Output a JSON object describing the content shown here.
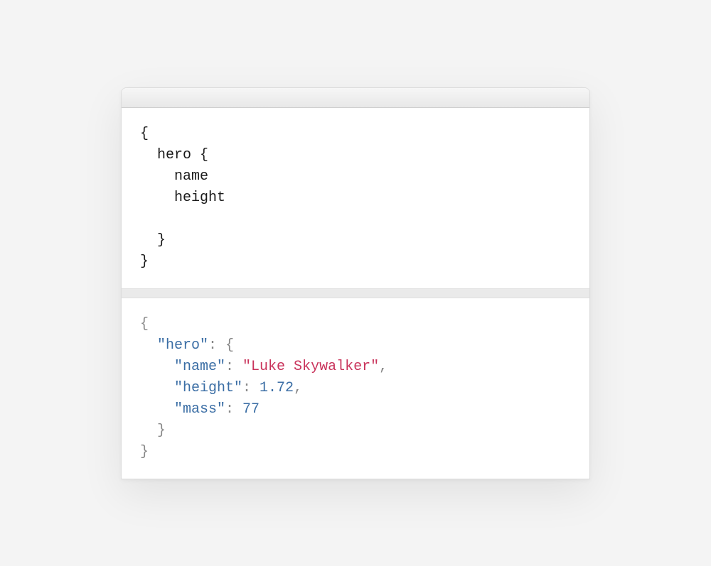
{
  "query": {
    "lines": [
      "{",
      "  hero {",
      "    name",
      "    height",
      "",
      "  }",
      "}"
    ]
  },
  "response": {
    "open_brace": "{",
    "indent1": "  ",
    "indent2": "    ",
    "hero_key": "\"hero\"",
    "colon_space": ": ",
    "open_brace2": "{",
    "name_key": "\"name\"",
    "name_value": "\"Luke Skywalker\"",
    "comma": ",",
    "height_key": "\"height\"",
    "height_value": "1.72",
    "mass_key": "\"mass\"",
    "mass_value": "77",
    "close_brace": "}",
    "close_brace2": "}"
  }
}
